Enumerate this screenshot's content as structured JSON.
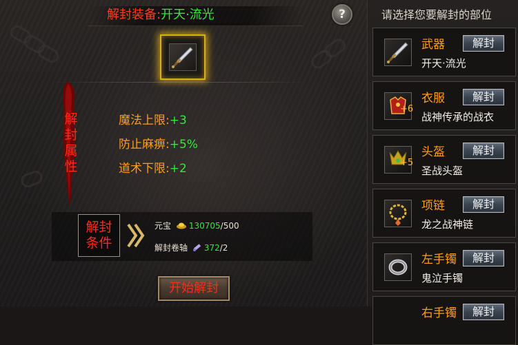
{
  "left": {
    "title_label": "解封装备:",
    "title_value": "开天·流光",
    "help_icon": "?",
    "attr_tag": "解封属性",
    "stats": [
      {
        "key": "魔法上限:",
        "value": "+3"
      },
      {
        "key": "防止麻痹:",
        "value": "+5%"
      },
      {
        "key": "道术下限:",
        "value": "+2"
      }
    ],
    "condition_label": "解封条件",
    "requirements": [
      {
        "name": "元宝",
        "icon": "gold-ingot-icon",
        "have": "130705",
        "need": "/500"
      },
      {
        "name": "解封卷轴",
        "icon": "scroll-icon",
        "have": "372",
        "need": "/2"
      }
    ],
    "start_button": "开始解封"
  },
  "right": {
    "title": "请选择您要解封的部位",
    "slots": [
      {
        "name": "武器",
        "item": "开天·流光",
        "button": "解封",
        "icon": "sword-icon",
        "plus": ""
      },
      {
        "name": "衣服",
        "item": "战神传承的战衣",
        "button": "解封",
        "icon": "armor-icon",
        "plus": "+6"
      },
      {
        "name": "头盔",
        "item": "圣战头盔",
        "button": "解封",
        "icon": "helmet-icon",
        "plus": "+5"
      },
      {
        "name": "项链",
        "item": "龙之战神链",
        "button": "解封",
        "icon": "necklace-icon",
        "plus": ""
      },
      {
        "name": "左手镯",
        "item": "鬼泣手镯",
        "button": "解封",
        "icon": "bracelet-icon",
        "plus": ""
      },
      {
        "name": "右手镯",
        "item": "",
        "button": "解封",
        "icon": "",
        "plus": ""
      }
    ]
  },
  "colors": {
    "red_label": "#ff2a18",
    "green_value": "#39e639",
    "orange_key": "#ff9d1c",
    "gold_border": "#d7b019"
  }
}
